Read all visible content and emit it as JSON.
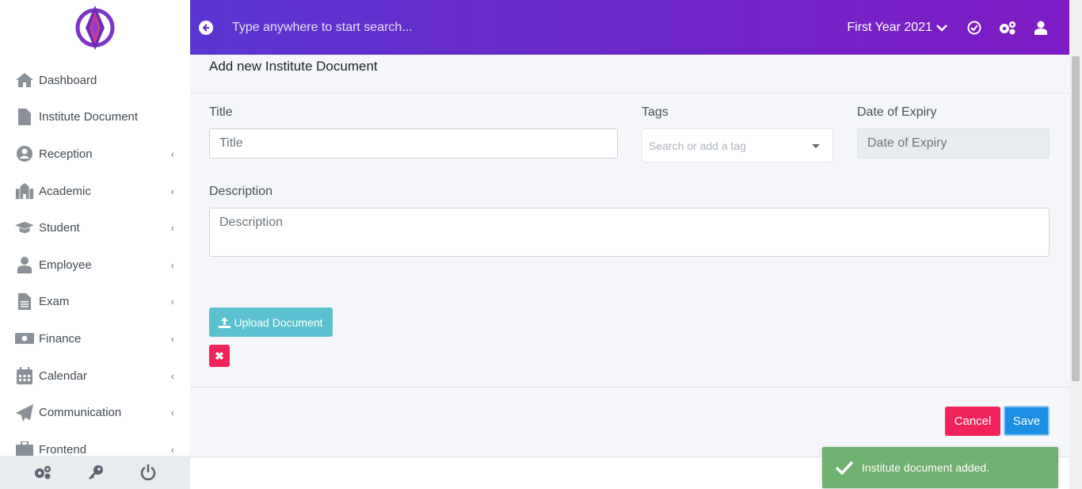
{
  "colors": {
    "header_start": "#5a35d1",
    "header_end": "#7c1cc4",
    "danger": "#f0245a",
    "primary": "#1a8fe3",
    "info": "#5bc0cf",
    "success_toast": "#6fb16f"
  },
  "sidebar": {
    "items": [
      {
        "label": "Dashboard",
        "icon": "home-icon",
        "has_submenu": false
      },
      {
        "label": "Institute Document",
        "icon": "file-icon",
        "has_submenu": false
      },
      {
        "label": "Reception",
        "icon": "user-circle-icon",
        "has_submenu": true
      },
      {
        "label": "Academic",
        "icon": "school-icon",
        "has_submenu": true
      },
      {
        "label": "Student",
        "icon": "graduation-cap-icon",
        "has_submenu": true
      },
      {
        "label": "Employee",
        "icon": "user-tie-icon",
        "has_submenu": true
      },
      {
        "label": "Exam",
        "icon": "file-alt-icon",
        "has_submenu": true
      },
      {
        "label": "Finance",
        "icon": "money-bill-icon",
        "has_submenu": true
      },
      {
        "label": "Calendar",
        "icon": "calendar-icon",
        "has_submenu": true
      },
      {
        "label": "Communication",
        "icon": "paper-plane-icon",
        "has_submenu": true
      },
      {
        "label": "Frontend",
        "icon": "briefcase-icon",
        "has_submenu": true
      }
    ],
    "chevron": "‹",
    "footer_icons": [
      "cogs-icon",
      "key-icon",
      "power-icon"
    ]
  },
  "header": {
    "search_placeholder": "Type anywhere to start search...",
    "session": "First Year 2021"
  },
  "form": {
    "heading": "Add new Institute Document",
    "title_label": "Title",
    "title_placeholder": "Title",
    "tags_label": "Tags",
    "tags_placeholder": "Search or add a tag",
    "expiry_label": "Date of Expiry",
    "expiry_placeholder": "Date of Expiry",
    "description_label": "Description",
    "description_placeholder": "Description",
    "upload_label": "Upload Document",
    "remove_label": "✖",
    "cancel_label": "Cancel",
    "save_label": "Save"
  },
  "toast": {
    "message": "Institute document added."
  }
}
